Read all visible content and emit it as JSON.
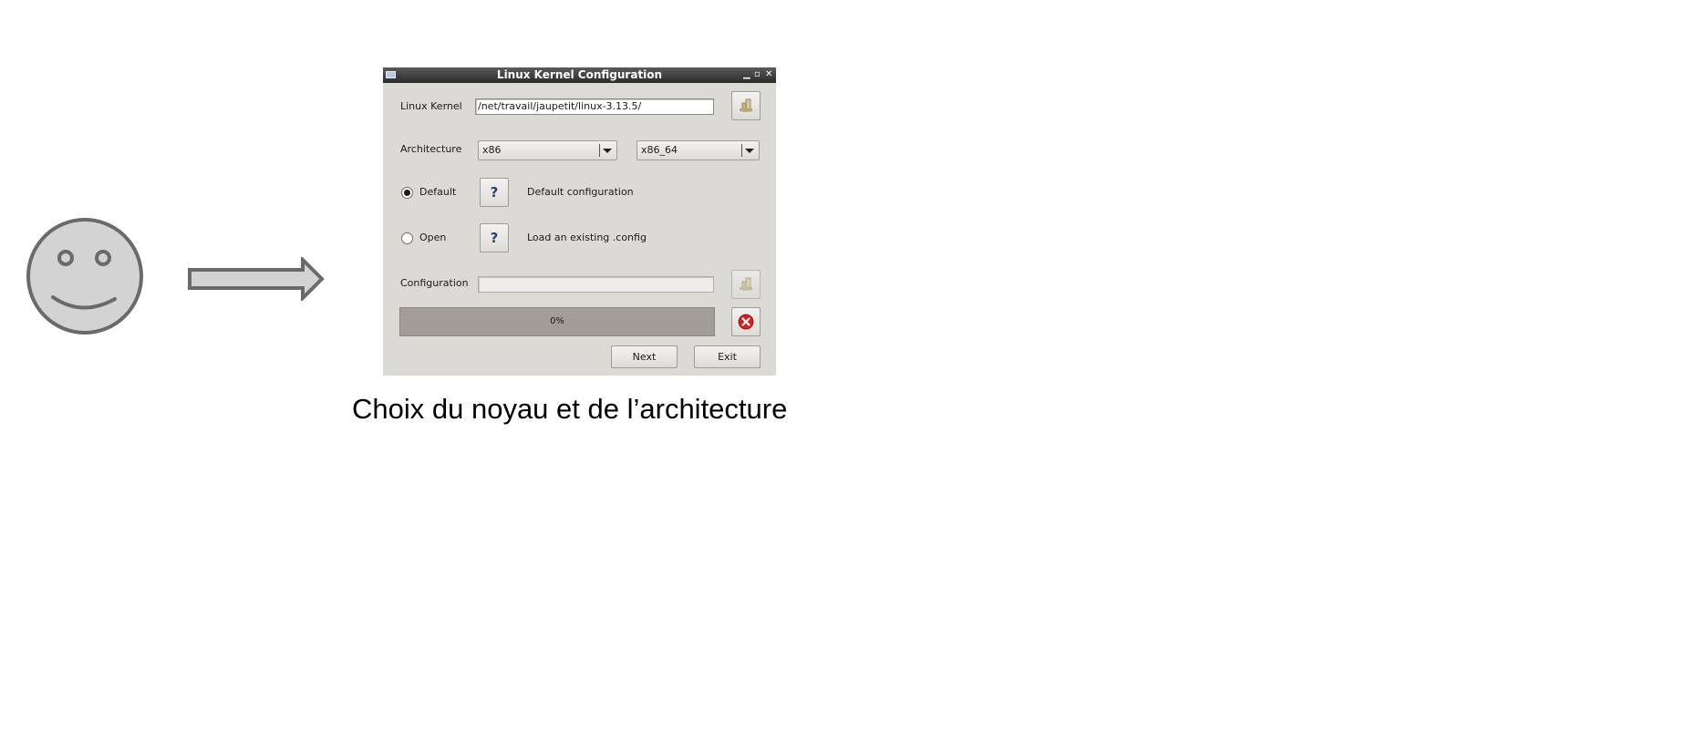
{
  "caption": "Choix du noyau et de l’architecture",
  "window": {
    "title": "Linux Kernel Configuration",
    "controls": [
      "minimize-icon",
      "maximize-icon",
      "close-icon"
    ],
    "kernel": {
      "label": "Linux Kernel",
      "path": "/net/travail/jaupetit/linux-3.13.5/",
      "browse_icon": "folder-browse-icon"
    },
    "architecture": {
      "label": "Architecture",
      "arch": "x86",
      "subarch": "x86_64"
    },
    "options": [
      {
        "label": "Default",
        "selected": true,
        "help": "?",
        "description": "Default configuration"
      },
      {
        "label": "Open",
        "selected": false,
        "help": "?",
        "description": "Load an existing .config"
      }
    ],
    "configuration": {
      "label": "Configuration",
      "value": "",
      "browse_icon": "folder-browse-icon"
    },
    "progress": {
      "text": "0%",
      "value": 0
    },
    "cancel_icon": "cancel-icon",
    "buttons": {
      "next": "Next",
      "exit": "Exit"
    }
  },
  "colors": {
    "window_bg": "#dcdad5",
    "titlebar": "#3a3a3a",
    "progress_bg": "#a29e97",
    "cancel_red": "#d42020",
    "illustration_fill": "#d3d3d3",
    "illustration_stroke": "#6a6a6a"
  }
}
